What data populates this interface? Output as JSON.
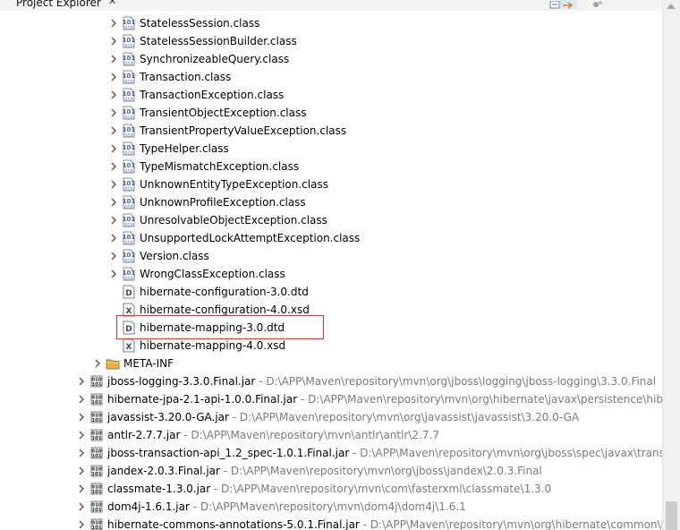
{
  "panel": {
    "title": "Project Explorer",
    "close_glyph": "✕",
    "toolbar": [
      "collapse-all-icon",
      "link-with-editor-icon",
      "view-menu-icon"
    ]
  },
  "tree": {
    "rows": [
      {
        "kind": "class",
        "label": "StatelessSession.class",
        "expand": "collapsed",
        "indent": 2,
        "icon": "class-file-icon"
      },
      {
        "kind": "class",
        "label": "StatelessSessionBuilder.class",
        "expand": "collapsed",
        "indent": 2,
        "icon": "class-file-icon"
      },
      {
        "kind": "class",
        "label": "SynchronizeableQuery.class",
        "expand": "collapsed",
        "indent": 2,
        "icon": "class-file-icon"
      },
      {
        "kind": "class",
        "label": "Transaction.class",
        "expand": "collapsed",
        "indent": 2,
        "icon": "class-file-icon"
      },
      {
        "kind": "class",
        "label": "TransactionException.class",
        "expand": "collapsed",
        "indent": 2,
        "icon": "class-file-icon"
      },
      {
        "kind": "class",
        "label": "TransientObjectException.class",
        "expand": "collapsed",
        "indent": 2,
        "icon": "class-file-icon"
      },
      {
        "kind": "class",
        "label": "TransientPropertyValueException.class",
        "expand": "collapsed",
        "indent": 2,
        "icon": "class-file-icon"
      },
      {
        "kind": "class",
        "label": "TypeHelper.class",
        "expand": "collapsed",
        "indent": 2,
        "icon": "class-file-icon"
      },
      {
        "kind": "class",
        "label": "TypeMismatchException.class",
        "expand": "collapsed",
        "indent": 2,
        "icon": "class-file-icon"
      },
      {
        "kind": "class",
        "label": "UnknownEntityTypeException.class",
        "expand": "collapsed",
        "indent": 2,
        "icon": "class-file-icon"
      },
      {
        "kind": "class",
        "label": "UnknownProfileException.class",
        "expand": "collapsed",
        "indent": 2,
        "icon": "class-file-icon"
      },
      {
        "kind": "class",
        "label": "UnresolvableObjectException.class",
        "expand": "collapsed",
        "indent": 2,
        "icon": "class-file-icon"
      },
      {
        "kind": "class",
        "label": "UnsupportedLockAttemptException.class",
        "expand": "collapsed",
        "indent": 2,
        "icon": "class-file-icon"
      },
      {
        "kind": "class",
        "label": "Version.class",
        "expand": "collapsed",
        "indent": 2,
        "icon": "class-file-icon"
      },
      {
        "kind": "class",
        "label": "WrongClassException.class",
        "expand": "collapsed",
        "indent": 2,
        "icon": "class-file-icon"
      },
      {
        "kind": "dtd",
        "label": "hibernate-configuration-3.0.dtd",
        "expand": "none",
        "indent": 2,
        "icon": "dtd-file-icon"
      },
      {
        "kind": "xsd",
        "label": "hibernate-configuration-4.0.xsd",
        "expand": "none",
        "indent": 2,
        "icon": "xsd-file-icon"
      },
      {
        "kind": "dtd",
        "label": "hibernate-mapping-3.0.dtd",
        "expand": "none",
        "indent": 2,
        "icon": "dtd-file-icon",
        "selected": true
      },
      {
        "kind": "xsd",
        "label": "hibernate-mapping-4.0.xsd",
        "expand": "none",
        "indent": 2,
        "icon": "xsd-file-icon"
      },
      {
        "kind": "folder",
        "label": "META-INF",
        "expand": "collapsed",
        "indent": 1,
        "icon": "folder-icon"
      },
      {
        "kind": "jar",
        "label": "jboss-logging-3.3.0.Final.jar",
        "path": " - D:\\APP\\Maven\\repository\\mvn\\org\\jboss\\logging\\jboss-logging\\3.3.0.Final",
        "expand": "collapsed",
        "indent": 0,
        "icon": "jar-icon"
      },
      {
        "kind": "jar",
        "label": "hibernate-jpa-2.1-api-1.0.0.Final.jar",
        "path": " - D:\\APP\\Maven\\repository\\mvn\\org\\hibernate\\javax\\persistence\\hiber",
        "expand": "collapsed",
        "indent": 0,
        "icon": "jar-icon"
      },
      {
        "kind": "jar",
        "label": "javassist-3.20.0-GA.jar",
        "path": " - D:\\APP\\Maven\\repository\\mvn\\org\\javassist\\javassist\\3.20.0-GA",
        "expand": "collapsed",
        "indent": 0,
        "icon": "jar-icon"
      },
      {
        "kind": "jar",
        "label": "antlr-2.7.7.jar",
        "path": " - D:\\APP\\Maven\\repository\\mvn\\antlr\\antlr\\2.7.7",
        "expand": "collapsed",
        "indent": 0,
        "icon": "jar-icon"
      },
      {
        "kind": "jar",
        "label": "jboss-transaction-api_1.2_spec-1.0.1.Final.jar",
        "path": " - D:\\APP\\Maven\\repository\\mvn\\org\\jboss\\spec\\javax\\transac",
        "expand": "collapsed",
        "indent": 0,
        "icon": "jar-icon"
      },
      {
        "kind": "jar",
        "label": "jandex-2.0.3.Final.jar",
        "path": " - D:\\APP\\Maven\\repository\\mvn\\org\\jboss\\jandex\\2.0.3.Final",
        "expand": "collapsed",
        "indent": 0,
        "icon": "jar-icon"
      },
      {
        "kind": "jar",
        "label": "classmate-1.3.0.jar",
        "path": " - D:\\APP\\Maven\\repository\\mvn\\com\\fasterxml\\classmate\\1.3.0",
        "expand": "collapsed",
        "indent": 0,
        "icon": "jar-icon"
      },
      {
        "kind": "jar",
        "label": "dom4j-1.6.1.jar",
        "path": " - D:\\APP\\Maven\\repository\\mvn\\dom4j\\dom4j\\1.6.1",
        "expand": "collapsed",
        "indent": 0,
        "icon": "jar-icon"
      },
      {
        "kind": "jar",
        "label": "hibernate-commons-annotations-5.0.1.Final.jar",
        "path": " - D:\\APP\\Maven\\repository\\mvn\\org\\hibernate\\common\\hib",
        "expand": "collapsed",
        "indent": 0,
        "icon": "jar-icon"
      }
    ]
  },
  "colors": {
    "selection_outline": "#d03c3c",
    "path_text": "#7a7a7a",
    "class_icon_blue": "#3b69b7",
    "folder_yellow": "#e8b04a"
  }
}
